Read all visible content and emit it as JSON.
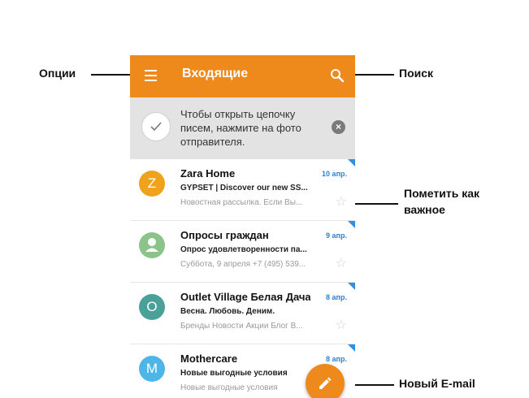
{
  "header": {
    "title": "Входящие"
  },
  "hint": {
    "text": "Чтобы открыть цепочку писем, нажмите на фото отправителя."
  },
  "emails": [
    {
      "avatar": "Z",
      "avatar_color": "#f0a21c",
      "sender": "Zara Home",
      "date": "10 апр.",
      "subject": "GYPSET | Discover our new SS...",
      "preview": "Новостная рассылка. Если Вы..."
    },
    {
      "avatar": "",
      "avatar_color": "#8bc38a",
      "sender": "Опросы граждан",
      "date": "9 апр.",
      "subject": "Опрос удовлетворенности па...",
      "preview": "Суббота, 9 апреля +7 (495) 539..."
    },
    {
      "avatar": "O",
      "avatar_color": "#4aa19a",
      "sender": "Outlet Village Белая Дача",
      "date": "8 апр.",
      "subject": "Весна. Любовь. Деним.",
      "preview": "Бренды Новости Акции Блог В..."
    },
    {
      "avatar": "M",
      "avatar_color": "#4db6e6",
      "sender": "Mothercare",
      "date": "8 апр.",
      "subject": "Новые выгодные условия",
      "preview": "Новые выгодные условия"
    }
  ],
  "callouts": {
    "options": "Опции",
    "search": "Поиск",
    "mark_important": "Пометить как важное",
    "new_email": "Новый E-mail"
  },
  "colors": {
    "appbar": "#ee8a1c",
    "date": "#2f7fd0",
    "flag": "#2f8fe0"
  },
  "icons": {
    "menu": "menu-icon",
    "search": "search-icon",
    "check": "check-icon",
    "close": "close-icon",
    "star": "star-icon",
    "compose": "pencil-icon",
    "person": "person-icon"
  }
}
